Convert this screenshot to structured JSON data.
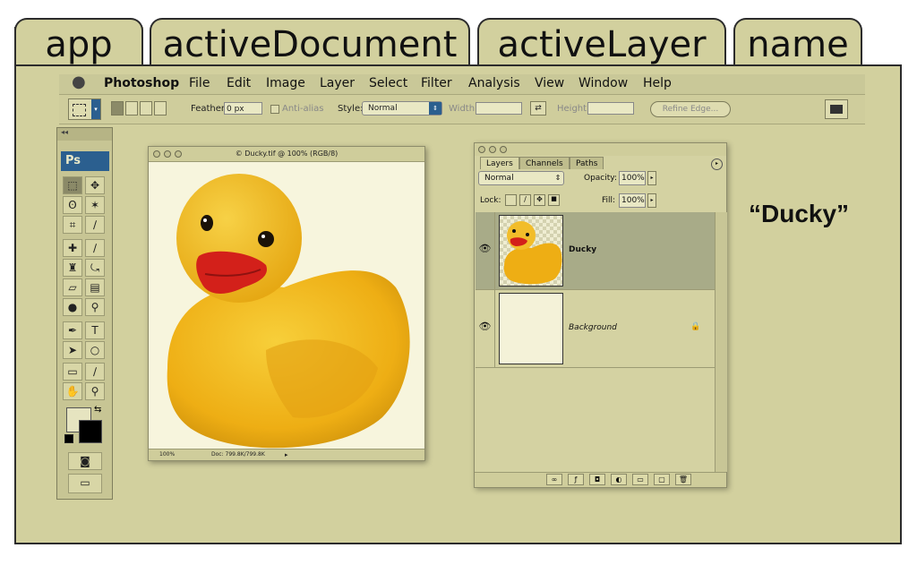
{
  "tabs": [
    "app",
    "activeDocument",
    "activeLayer",
    "name"
  ],
  "menubar": {
    "apple_icon": "apple-icon",
    "items": [
      "Photoshop",
      "File",
      "Edit",
      "Image",
      "Layer",
      "Select",
      "Filter",
      "Analysis",
      "View",
      "Window",
      "Help"
    ]
  },
  "options_bar": {
    "feather_label": "Feather:",
    "feather_value": "0 px",
    "antialias_label": "Anti-alias",
    "style_label": "Style:",
    "style_value": "Normal",
    "width_label": "Width:",
    "height_label": "Height:",
    "refine_edge_label": "Refine Edge..."
  },
  "tools": {
    "logo": "Ps",
    "toggle": "◂◂"
  },
  "document": {
    "title": "© Ducky.tif @ 100% (RGB/8)",
    "zoom": "100%",
    "doc_info": "Doc: 799.8K/799.8K"
  },
  "layers_panel": {
    "tabs": [
      "Layers",
      "Channels",
      "Paths"
    ],
    "blend_mode": "Normal",
    "opacity_label": "Opacity:",
    "opacity_value": "100%",
    "lock_label": "Lock:",
    "fill_label": "Fill:",
    "fill_value": "100%",
    "layers": [
      {
        "name": "Ducky",
        "selected": true
      },
      {
        "name": "Background",
        "locked": true
      }
    ]
  },
  "annotation": {
    "text": "“Ducky”"
  },
  "colors": {
    "panel": "#d2d09e",
    "border": "#2c2c2c",
    "duck_yellow": "#f2b81a",
    "beak_red": "#d8211b",
    "ps_blue": "#2b5f8f"
  }
}
